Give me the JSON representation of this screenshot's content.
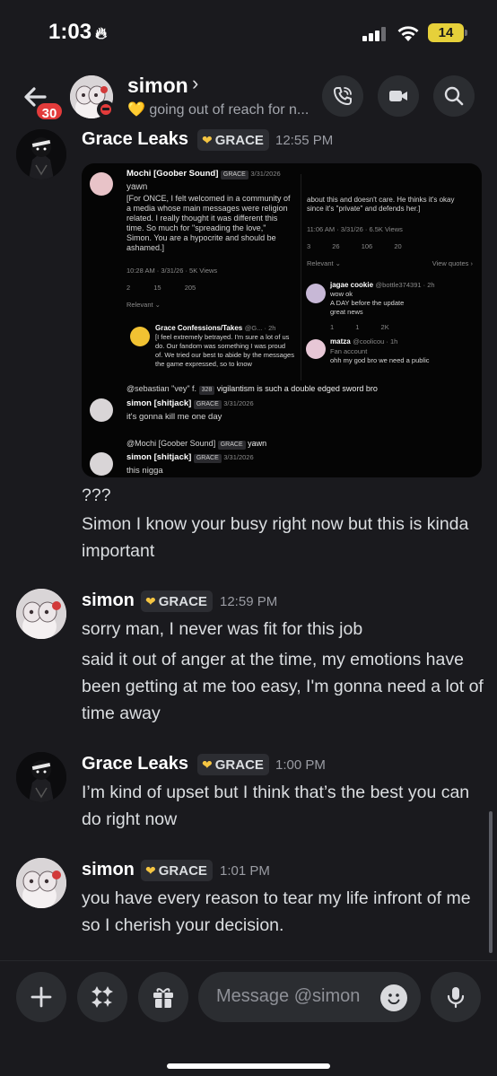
{
  "status_bar": {
    "time": "1:03",
    "time_icon": "flame-icon",
    "battery": "14"
  },
  "header": {
    "back_badge": "30",
    "name": "simon",
    "chevron": "›",
    "status_emoji": "💛",
    "status_text": "going out of reach for n..."
  },
  "messages": [
    {
      "author": "Grace Leaks",
      "tag": "GRACE",
      "time": "12:55 PM",
      "lines": [
        "???",
        "Simon I know your busy right now but this is kinda important"
      ]
    },
    {
      "author": "simon",
      "tag": "GRACE",
      "time": "12:59 PM",
      "lines": [
        "sorry man, I never was fit for this job",
        "said it out of anger at the time, my emotions have been getting at me too easy, I'm gonna need a lot of time away"
      ]
    },
    {
      "author": "Grace Leaks",
      "tag": "GRACE",
      "time": "1:00 PM",
      "lines": [
        "I’m kind of upset but I think that’s the best you can do right now"
      ]
    },
    {
      "author": "simon",
      "tag": "GRACE",
      "time": "1:01 PM",
      "lines": [
        "you have every reason to tear my life infront of me so I cherish your decision."
      ]
    }
  ],
  "embed": {
    "post1": {
      "author": "Mochi [Goober Sound]",
      "tag": "GRACE",
      "date": "3/31/2026",
      "line1": "yawn",
      "body": "[For ONCE, I felt welcomed in a community of a media whose main messages were religion related. I really thought it was different this time. So much for \"spreading the love,\" Simon. You are a hypocrite and should be ashamed.]",
      "meta": "10:28 AM · 3/31/26 · 5K Views",
      "stats": [
        "2",
        "15",
        "205"
      ],
      "relevant": "Relevant ⌄"
    },
    "post2": {
      "author": "Grace Confessions/Takes",
      "handle": "@G... · 2h",
      "body": "[I feel extremely betrayed. I'm sure a lot of us do. Our fandom was something I was proud of. We tried our best to abide by the messages the game expressed, so to know"
    },
    "post3": {
      "body": "about this and doesn't care. He thinks it's okay since it's \"private\" and defends her.]",
      "meta": "11:06 AM · 3/31/26 · 6.5K Views",
      "stats": [
        "3",
        "26",
        "106",
        "20"
      ],
      "relevant": "Relevant ⌄",
      "view_quotes": "View quotes ›"
    },
    "post4": {
      "author": "jagae cookie",
      "handle": "@bottle374391 · 2h",
      "lines": [
        "wow ok",
        "A DAY before the update",
        "great news"
      ],
      "stats": [
        "1",
        "1",
        "2K"
      ]
    },
    "post5": {
      "author": "matza",
      "handle": "@coolicou · 1h",
      "sub": "Fan account",
      "body": "ohh my god bro we need a public"
    },
    "reply1": {
      "ref": "@sebastian \"vey\" f.",
      "ref_badge": "328",
      "ref_text": "vigilantism is such a double edged sword bro",
      "author": "simon [shitjack]",
      "tag": "GRACE",
      "date": "3/31/2026",
      "text": "it's gonna kill me one day"
    },
    "reply2": {
      "ref": "@Mochi [Goober Sound]",
      "ref_tag": "GRACE",
      "ref_text": "yawn",
      "author": "simon [shitjack]",
      "tag": "GRACE",
      "date": "3/31/2026",
      "text": "this nigga"
    }
  },
  "composer": {
    "placeholder": "Message @simon"
  },
  "colors": {
    "background": "#1a1a1e",
    "tag_bg": "#2c2d32",
    "heart": "#f5c542",
    "badge": "#e33b3b"
  }
}
